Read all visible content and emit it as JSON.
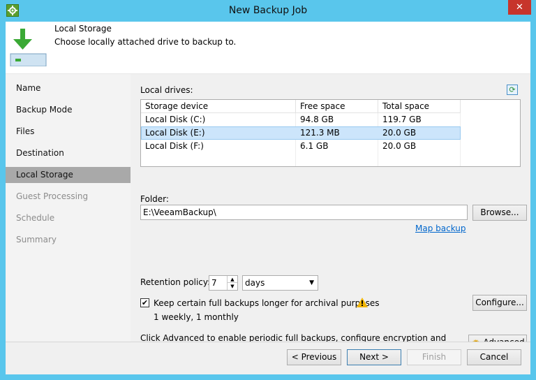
{
  "window": {
    "title": "New Backup Job",
    "close_glyph": "✕",
    "app_icon": "gear-icon"
  },
  "header": {
    "title": "Local Storage",
    "subtitle": "Choose locally attached drive to backup to."
  },
  "sidebar": {
    "items": [
      {
        "label": "Name",
        "state": "normal"
      },
      {
        "label": "Backup Mode",
        "state": "normal"
      },
      {
        "label": "Files",
        "state": "normal"
      },
      {
        "label": "Destination",
        "state": "normal"
      },
      {
        "label": "Local Storage",
        "state": "active"
      },
      {
        "label": "Guest Processing",
        "state": "disabled"
      },
      {
        "label": "Schedule",
        "state": "disabled"
      },
      {
        "label": "Summary",
        "state": "disabled"
      }
    ]
  },
  "main": {
    "local_drives_label": "Local drives:",
    "refresh_icon": "refresh-icon",
    "table": {
      "columns": [
        "Storage device",
        "Free space",
        "Total space"
      ],
      "rows": [
        [
          "Local Disk (C:)",
          "94.8 GB",
          "119.7 GB"
        ],
        [
          "Local Disk (E:)",
          "121.3 MB",
          "20.0 GB"
        ],
        [
          "Local Disk (F:)",
          "6.1 GB",
          "20.0 GB"
        ]
      ],
      "selected_row": 1
    },
    "folder_label": "Folder:",
    "folder_value": "E:\\VeeamBackup\\",
    "browse_label": "Browse...",
    "map_backup_label": "Map backup",
    "retention_label": "Retention policy:",
    "retention_value": "7",
    "retention_unit": "days",
    "keep_checkbox_checked": true,
    "keep_label": "Keep certain full backups longer for archival purposes",
    "keep_summary": "1 weekly, 1 monthly",
    "configure_label": "Configure...",
    "advanced_text": "Click Advanced to enable periodic full backups, configure encryption and other backup file settings",
    "advanced_label": "Advanced"
  },
  "footer": {
    "previous_label": "< Previous",
    "next_label": "Next >",
    "finish_label": "Finish",
    "cancel_label": "Cancel"
  },
  "colors": {
    "titlebar": "#59c6ec",
    "close": "#c7352b",
    "sidebar_active": "#a9a9a9",
    "selection": "#cce5fb",
    "link": "#0066cc",
    "warning": "#f0b400"
  }
}
